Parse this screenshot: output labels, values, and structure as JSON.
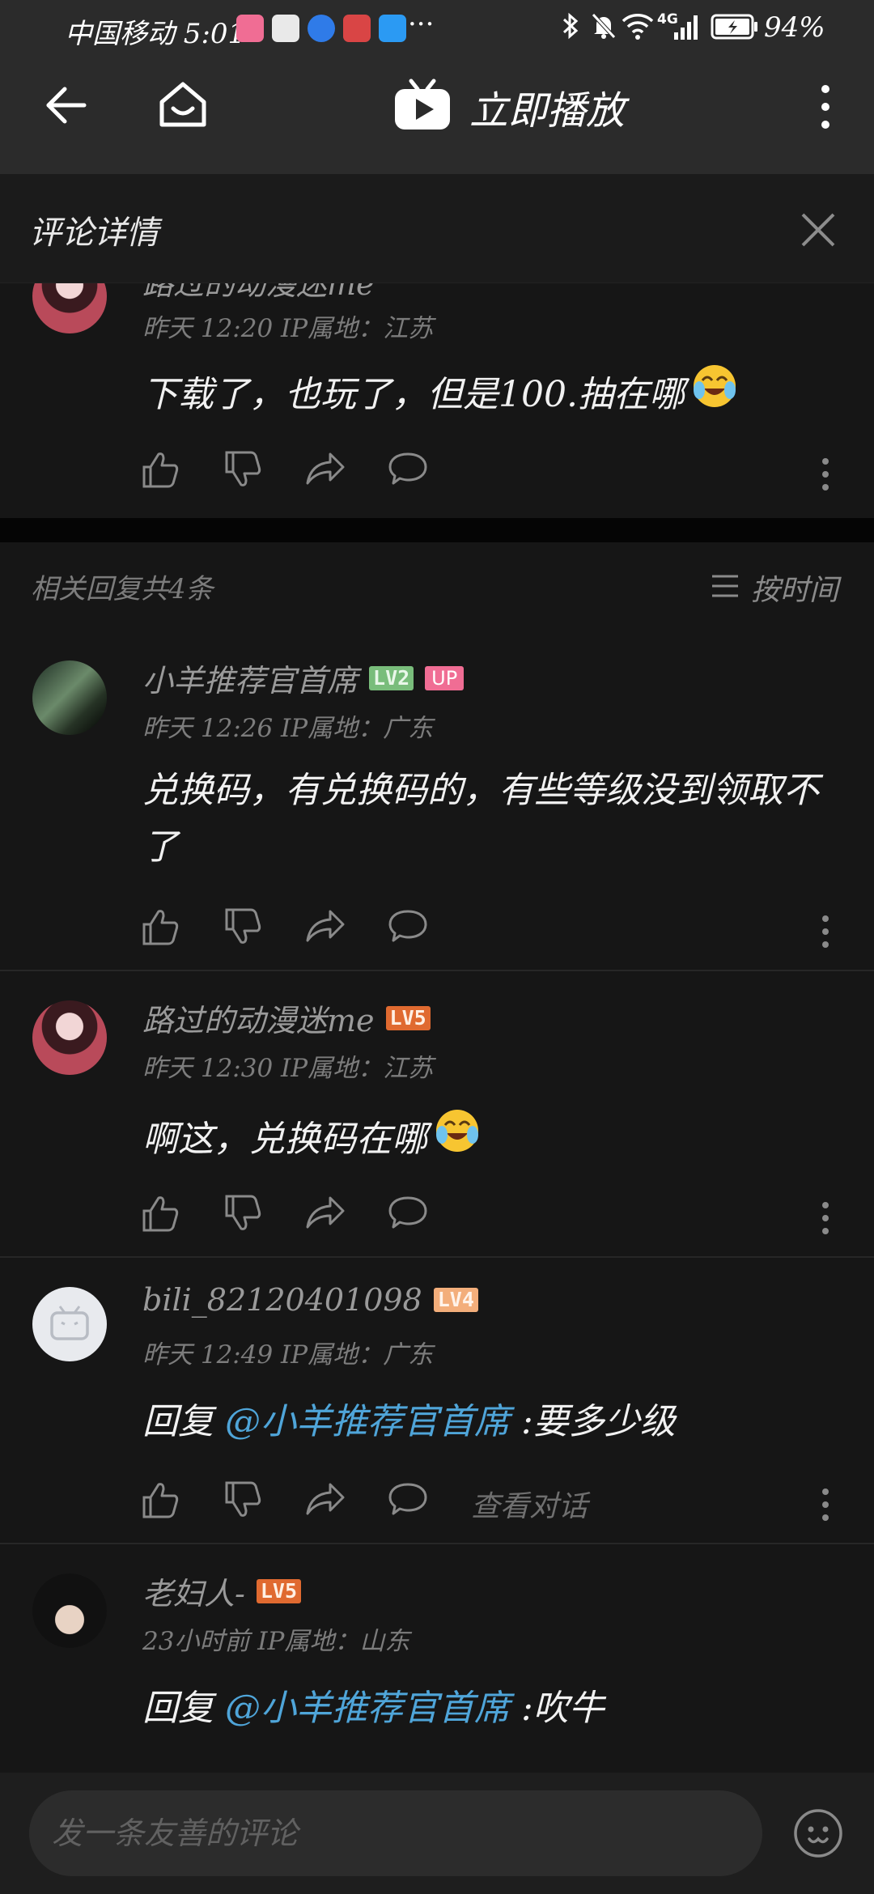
{
  "status_bar": {
    "carrier_time": "中国移动 5:01",
    "more": "···",
    "network": "4G",
    "battery": "94%"
  },
  "top_bar": {
    "title": "立即播放"
  },
  "panel": {
    "title": "评论详情"
  },
  "root_comment": {
    "username": "路过的动漫迷me",
    "meta": "昨天 12:20  IP属地：江苏",
    "text": "下载了，也玩了，但是100.抽在哪"
  },
  "replies_header": {
    "count_text": "相关回复共4条",
    "sort_label": "按时间"
  },
  "replies": [
    {
      "username": "小羊推荐官首席",
      "level": "LV2",
      "up_badge": "UP",
      "meta": "昨天 12:26  IP属地：广东",
      "text_line1": "兑换码，有兑换码的，有些等级没到领取不",
      "text_line2": "了"
    },
    {
      "username": "路过的动漫迷me",
      "level": "LV5",
      "meta": "昨天 12:30  IP属地：江苏",
      "text": "啊这，兑换码在哪"
    },
    {
      "username": "bili_82120401098",
      "level": "LV4",
      "meta": "昨天 12:49  IP属地：广东",
      "reply_prefix": "回复 ",
      "mention": "@小羊推荐官首席",
      "text": " :要多少级",
      "see_conversation": "查看对话"
    },
    {
      "username": "老妇人-",
      "level": "LV5",
      "meta": "23小时前  IP属地：山东",
      "reply_prefix": "回复 ",
      "mention": "@小羊推荐官首席",
      "text": " :吹牛"
    }
  ],
  "input": {
    "placeholder": "发一条友善的评论"
  },
  "colors": {
    "background": "#161616",
    "top_bar": "#2b2b2b",
    "mention": "#4fa5d9",
    "lv2": "#79bd7b",
    "lv4": "#f3ae7b",
    "lv5": "#e06a30",
    "up": "#f06d94"
  }
}
